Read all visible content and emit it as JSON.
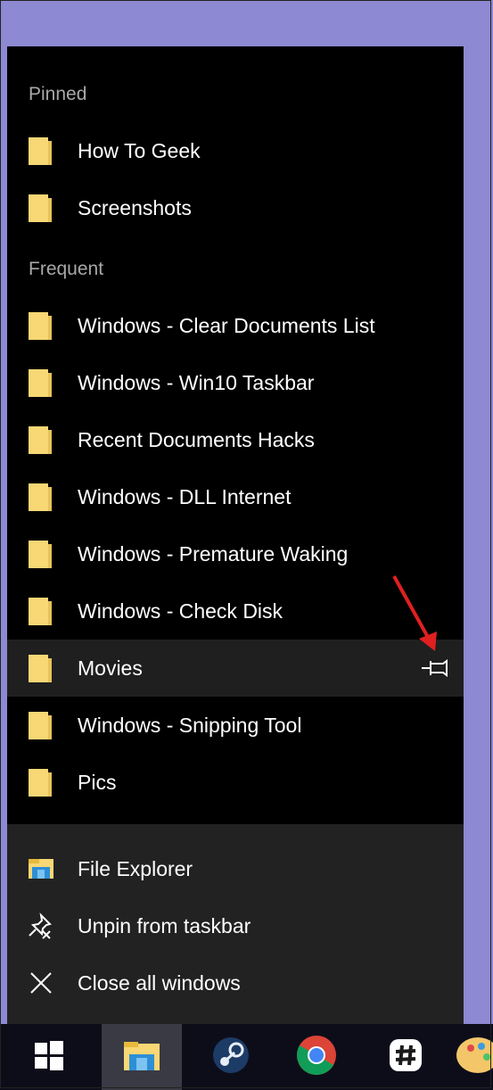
{
  "jumplist": {
    "pinned_header": "Pinned",
    "pinned": [
      {
        "label": "How To Geek"
      },
      {
        "label": "Screenshots"
      }
    ],
    "frequent_header": "Frequent",
    "frequent": [
      {
        "label": "Windows - Clear Documents List"
      },
      {
        "label": "Windows - Win10 Taskbar"
      },
      {
        "label": "Recent Documents Hacks"
      },
      {
        "label": "Windows - DLL Internet"
      },
      {
        "label": "Windows - Premature Waking"
      },
      {
        "label": "Windows - Check Disk"
      },
      {
        "label": "Movies",
        "hovered": true,
        "action_icon": "pin-icon"
      },
      {
        "label": "Windows - Snipping Tool"
      },
      {
        "label": "Pics"
      }
    ]
  },
  "tasks": [
    {
      "label": "File Explorer",
      "icon": "file-explorer-icon"
    },
    {
      "label": "Unpin from taskbar",
      "icon": "unpin-icon"
    },
    {
      "label": "Close all windows",
      "icon": "close-icon"
    }
  ],
  "taskbar": {
    "items": [
      {
        "name": "start-button",
        "icon": "windows-logo-icon"
      },
      {
        "name": "file-explorer-taskbar-button",
        "icon": "file-explorer-icon",
        "active": true
      },
      {
        "name": "steam-taskbar-button",
        "icon": "steam-icon"
      },
      {
        "name": "chrome-taskbar-button",
        "icon": "chrome-icon"
      },
      {
        "name": "slack-taskbar-button",
        "icon": "slack-icon"
      },
      {
        "name": "paint-taskbar-button",
        "icon": "paint-icon"
      }
    ]
  },
  "colors": {
    "desktop": "#8d89d2",
    "jumplist_bg": "#000000",
    "tasks_bg": "#222222",
    "hover_bg": "#1f1f1f",
    "folder": "#f8d775",
    "annotation_arrow": "#e02020"
  }
}
